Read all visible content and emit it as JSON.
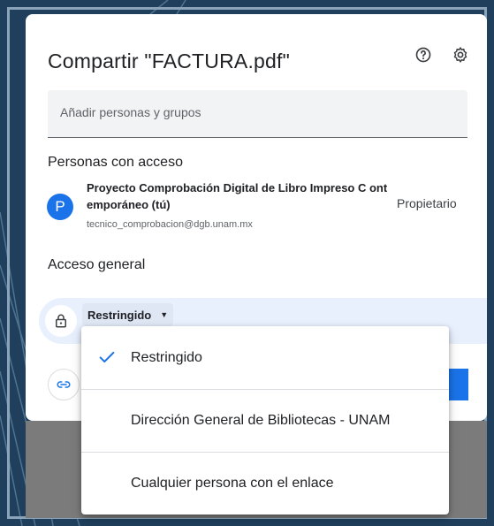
{
  "dialog": {
    "title": "Compartir \"FACTURA.pdf\"",
    "add_people_placeholder": "Añadir personas y grupos"
  },
  "people": {
    "section_title": "Personas con acceso",
    "items": [
      {
        "avatar_letter": "P",
        "name": "Proyecto Comprobación Digital de Libro Impreso C ontemporáneo (tú)",
        "email": "tecnico_comprobacion@dgb.unam.mx",
        "role": "Propietario"
      }
    ]
  },
  "general_access": {
    "section_title": "Acceso general",
    "selected": "Restringido"
  },
  "dropdown": {
    "options": [
      {
        "label": "Restringido",
        "checked": true
      },
      {
        "label": "Dirección General de Bibliotecas - UNAM",
        "checked": false
      },
      {
        "label": "Cualquier persona con el enlace",
        "checked": false
      }
    ]
  },
  "icons": {
    "help": "help-circle-icon",
    "settings": "gear-icon",
    "lock": "lock-icon",
    "link": "link-icon",
    "check": "check-icon",
    "caret": "caret-down-icon"
  },
  "colors": {
    "accent": "#1a73e8",
    "row_highlight": "#e8f0fe",
    "background": "#1f3f5c"
  }
}
